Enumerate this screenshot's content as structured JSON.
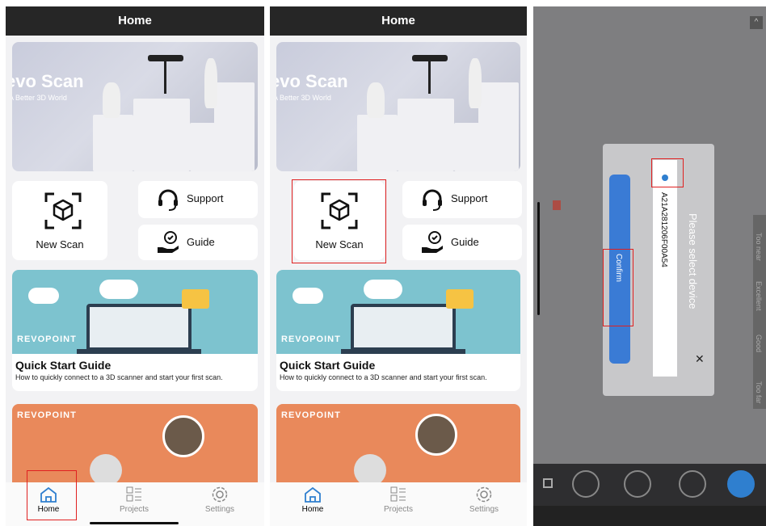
{
  "colors": {
    "topbar": "#262626",
    "highlight": "#e02020",
    "confirm": "#3a7bd5",
    "hero_bg": "#c9ccdc",
    "qs_bg": "#7dc3cf",
    "orange": "#e9895b"
  },
  "screen1": {
    "title": "Home",
    "hero": {
      "title": "evo Scan",
      "subtitle": "A Better 3D World"
    },
    "actions": {
      "new_scan": "New Scan",
      "support": "Support",
      "guide": "Guide"
    },
    "quick_start": {
      "brand": "REVOPOINT",
      "title": "Quick Start Guide",
      "description": "How to quickly connect to a 3D scanner and start your first scan."
    },
    "promo": {
      "brand": "REVOPOINT"
    },
    "tabs": [
      {
        "label": "Home",
        "icon": "home-icon"
      },
      {
        "label": "Projects",
        "icon": "projects-icon"
      },
      {
        "label": "Settings",
        "icon": "settings-icon"
      }
    ]
  },
  "screen2": {
    "title": "Home",
    "hero": {
      "title": "evo Scan",
      "subtitle": "A Better 3D World"
    },
    "actions": {
      "new_scan": "New Scan",
      "support": "Support",
      "guide": "Guide"
    },
    "quick_start": {
      "brand": "REVOPOINT",
      "title": "Quick Start Guide",
      "description": "How to quickly connect to a 3D scanner and start your first scan."
    },
    "promo": {
      "brand": "REVOPOINT"
    },
    "tabs": [
      {
        "label": "Home",
        "icon": "home-icon"
      },
      {
        "label": "Projects",
        "icon": "projects-icon"
      },
      {
        "label": "Settings",
        "icon": "settings-icon"
      }
    ]
  },
  "screen3": {
    "dialog": {
      "title": "Please select device",
      "device": "A21A281206F00A54",
      "confirm_label": "Confirm",
      "close": "✕"
    },
    "distance_labels": [
      "Too near",
      "Excellent",
      "Good",
      "Too far"
    ]
  }
}
